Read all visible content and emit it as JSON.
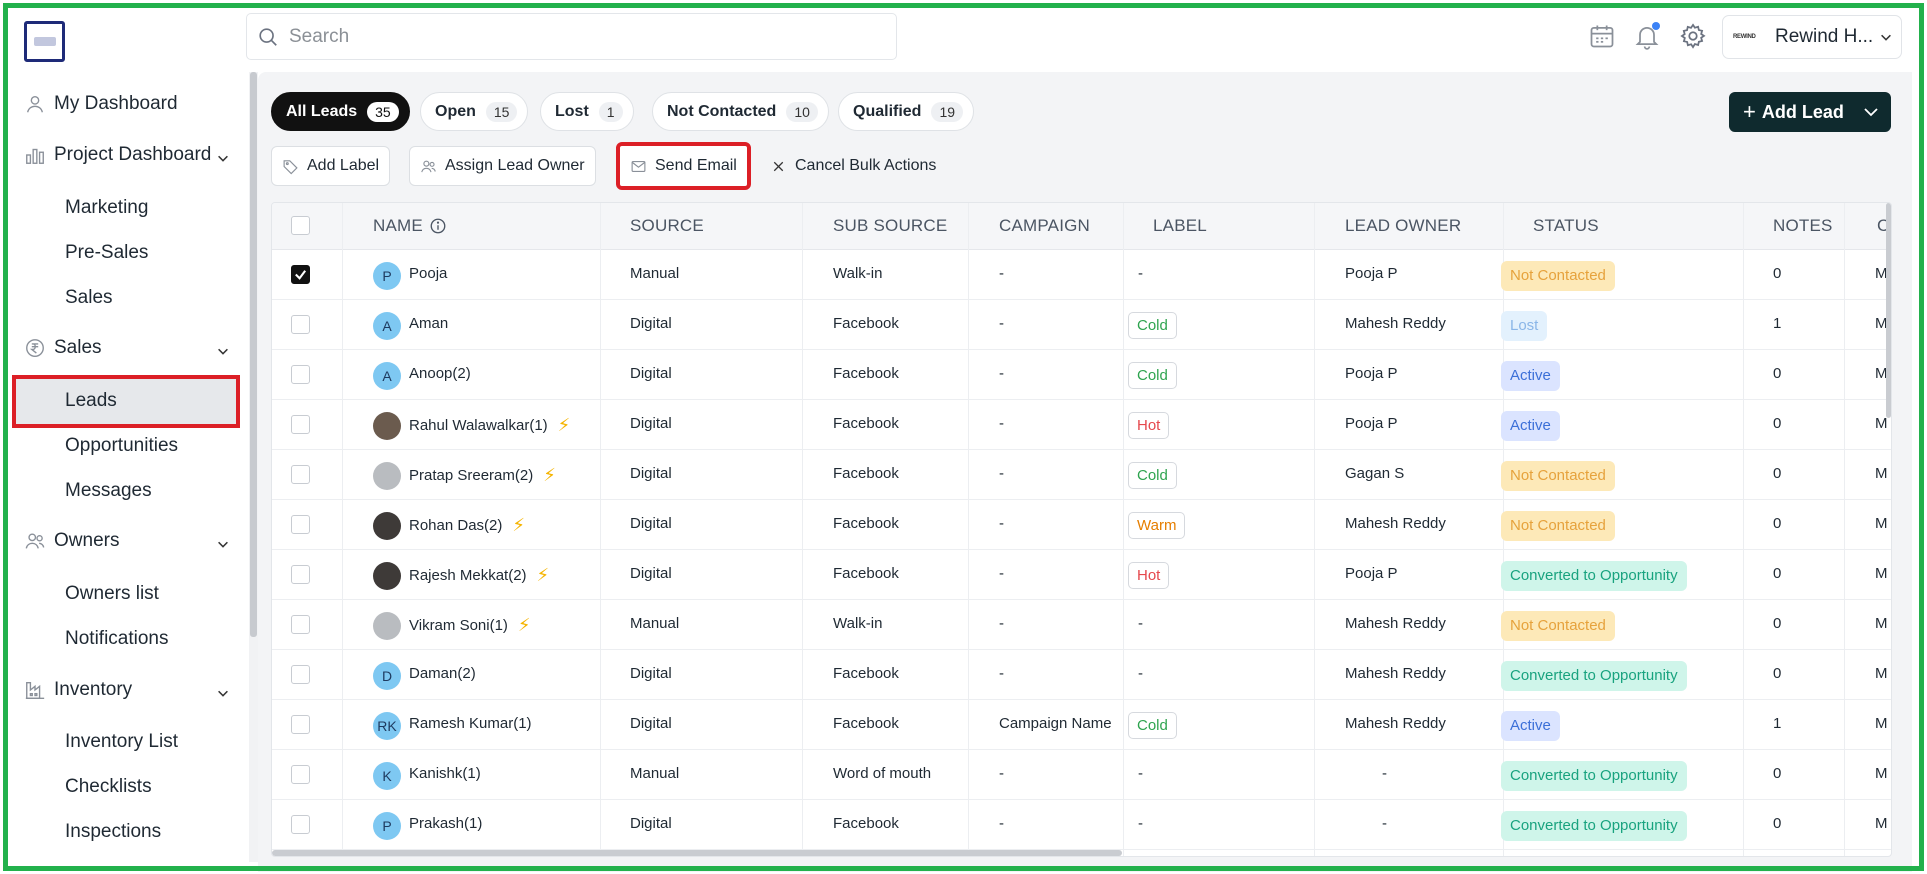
{
  "header": {
    "search_placeholder": "Search",
    "account_logo_text": "REWIND",
    "account_name": "Rewind H...",
    "notification_dot_color": "#3b82f6"
  },
  "sidebar": {
    "my_dashboard": "My Dashboard",
    "project_dashboard": "Project Dashboard",
    "project_items": [
      "Marketing",
      "Pre-Sales",
      "Sales"
    ],
    "sales": "Sales",
    "sales_items": [
      "Leads",
      "Opportunities",
      "Messages"
    ],
    "owners": "Owners",
    "owners_items": [
      "Owners list",
      "Notifications"
    ],
    "inventory": "Inventory",
    "inventory_items": [
      "Inventory List",
      "Checklists",
      "Inspections"
    ]
  },
  "filters": [
    {
      "label": "All Leads",
      "count": "35",
      "active": true
    },
    {
      "label": "Open",
      "count": "15"
    },
    {
      "label": "Lost",
      "count": "1"
    },
    {
      "label": "Not Contacted",
      "count": "10"
    },
    {
      "label": "Qualified",
      "count": "19"
    }
  ],
  "add_lead_label": "Add Lead",
  "toolbar": {
    "add_label": "Add Label",
    "assign_owner": "Assign Lead Owner",
    "send_email": "Send Email",
    "cancel_bulk": "Cancel Bulk Actions"
  },
  "table": {
    "headers": [
      "NAME",
      "SOURCE",
      "SUB SOURCE",
      "CAMPAIGN",
      "LABEL",
      "LEAD OWNER",
      "STATUS",
      "NOTES",
      "C"
    ],
    "rows": [
      {
        "initials": "P",
        "name": "Pooja",
        "bolt": false,
        "checked": true,
        "source": "Manual",
        "sub": "Walk-in",
        "campaign": "-",
        "label": "-",
        "owner": "Pooja P",
        "status": "Not Contacted",
        "notes": "0",
        "extra": "M"
      },
      {
        "initials": "A",
        "name": "Aman",
        "bolt": false,
        "checked": false,
        "source": "Digital",
        "sub": "Facebook",
        "campaign": "-",
        "label": "Cold",
        "owner": "Mahesh Reddy",
        "status": "Lost",
        "notes": "1",
        "extra": "M"
      },
      {
        "initials": "A",
        "name": "Anoop(2)",
        "bolt": false,
        "checked": false,
        "source": "Digital",
        "sub": "Facebook",
        "campaign": "-",
        "label": "Cold",
        "owner": "Pooja P",
        "status": "Active",
        "notes": "0",
        "extra": "M"
      },
      {
        "initials": "",
        "photo": "photo",
        "name": "Rahul Walawalkar(1)",
        "bolt": true,
        "checked": false,
        "source": "Digital",
        "sub": "Facebook",
        "campaign": "-",
        "label": "Hot",
        "owner": "Pooja P",
        "status": "Active",
        "notes": "0",
        "extra": "M"
      },
      {
        "initials": "",
        "photo": "photo3",
        "name": "Pratap Sreeram(2)",
        "bolt": true,
        "checked": false,
        "source": "Digital",
        "sub": "Facebook",
        "campaign": "-",
        "label": "Cold",
        "owner": "Gagan S",
        "status": "Not Contacted",
        "notes": "0",
        "extra": "M"
      },
      {
        "initials": "",
        "photo": "photo2",
        "name": "Rohan Das(2)",
        "bolt": true,
        "checked": false,
        "source": "Digital",
        "sub": "Facebook",
        "campaign": "-",
        "label": "Warm",
        "owner": "Mahesh Reddy",
        "status": "Not Contacted",
        "notes": "0",
        "extra": "M"
      },
      {
        "initials": "",
        "photo": "photo2",
        "name": "Rajesh Mekkat(2)",
        "bolt": true,
        "checked": false,
        "source": "Digital",
        "sub": "Facebook",
        "campaign": "-",
        "label": "Hot",
        "owner": "Pooja P",
        "status": "Converted to Opportunity",
        "notes": "0",
        "extra": "M"
      },
      {
        "initials": "",
        "photo": "photo3",
        "name": "Vikram Soni(1)",
        "bolt": true,
        "checked": false,
        "source": "Manual",
        "sub": "Walk-in",
        "campaign": "-",
        "label": "-",
        "owner": "Mahesh Reddy",
        "status": "Not Contacted",
        "notes": "0",
        "extra": "M"
      },
      {
        "initials": "D",
        "name": "Daman(2)",
        "bolt": false,
        "checked": false,
        "source": "Digital",
        "sub": "Facebook",
        "campaign": "-",
        "label": "-",
        "owner": "Mahesh Reddy",
        "status": "Converted to Opportunity",
        "notes": "0",
        "extra": "M"
      },
      {
        "initials": "RK",
        "name": "Ramesh Kumar(1)",
        "bolt": false,
        "checked": false,
        "source": "Digital",
        "sub": "Facebook",
        "campaign": "Campaign Name",
        "label": "Cold",
        "owner": "Mahesh Reddy",
        "status": "Active",
        "notes": "1",
        "extra": "M"
      },
      {
        "initials": "K",
        "name": "Kanishk(1)",
        "bolt": false,
        "checked": false,
        "source": "Manual",
        "sub": "Word of mouth",
        "campaign": "-",
        "label": "-",
        "owner": "-",
        "status": "Converted to Opportunity",
        "notes": "0",
        "extra": "M"
      },
      {
        "initials": "P",
        "name": "Prakash(1)",
        "bolt": false,
        "checked": false,
        "source": "Digital",
        "sub": "Facebook",
        "campaign": "-",
        "label": "-",
        "owner": "-",
        "status": "Converted to Opportunity",
        "notes": "0",
        "extra": "M"
      }
    ]
  },
  "colors": {
    "label": {
      "Cold": "#2ea44f",
      "Hot": "#e5484d",
      "Warm": "#e67e00"
    },
    "status": {
      "Not Contacted": {
        "bg": "#fde9b8",
        "fg": "#e6a23c"
      },
      "Lost": {
        "bg": "#e3f1fd",
        "fg": "#8ab6e8"
      },
      "Active": {
        "bg": "#dbe4ff",
        "fg": "#3b6fd8"
      },
      "Converted to Opportunity": {
        "bg": "#cff5ea",
        "fg": "#19a37f"
      }
    }
  }
}
